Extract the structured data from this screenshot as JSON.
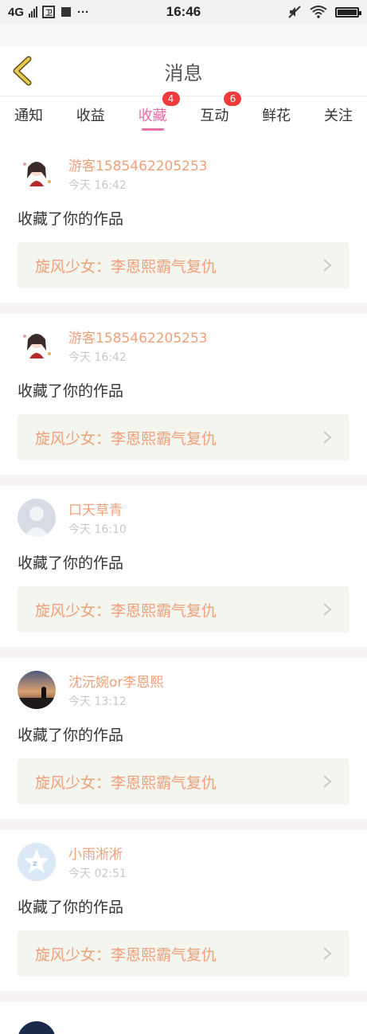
{
  "status_bar": {
    "network": "4G",
    "time": "16:46",
    "dots": "···"
  },
  "header": {
    "title": "消息"
  },
  "tabs": [
    {
      "label": "通知"
    },
    {
      "label": "收益"
    },
    {
      "label": "收藏",
      "active": true,
      "badge": "4"
    },
    {
      "label": "互动",
      "badge": "6"
    },
    {
      "label": "鲜花"
    },
    {
      "label": "关注"
    }
  ],
  "messages": [
    {
      "user": "游客1585462205253",
      "time": "今天 16:42",
      "action": "收藏了你的作品",
      "work": "旋风少女：李恩熙霸气复仇",
      "avatar": "anime-girl"
    },
    {
      "user": "游客1585462205253",
      "time": "今天 16:42",
      "action": "收藏了你的作品",
      "work": "旋风少女：李恩熙霸气复仇",
      "avatar": "anime-girl"
    },
    {
      "user": "口天草青",
      "time": "今天 16:10",
      "action": "收藏了你的作品",
      "work": "旋风少女：李恩熙霸气复仇",
      "avatar": "default-person"
    },
    {
      "user": "沈沅婉or李恩熙",
      "time": "今天 13:12",
      "action": "收藏了你的作品",
      "work": "旋风少女：李恩熙霸气复仇",
      "avatar": "sunset-photo"
    },
    {
      "user": "小雨淅淅",
      "time": "今天 02:51",
      "action": "收藏了你的作品",
      "work": "旋风少女：李恩熙霸气复仇",
      "avatar": "qzone-star"
    }
  ],
  "colors": {
    "accent": "#e86fa5",
    "username": "#f0a079",
    "badge": "#ef3b3b",
    "back_arrow": "#e0c040"
  }
}
